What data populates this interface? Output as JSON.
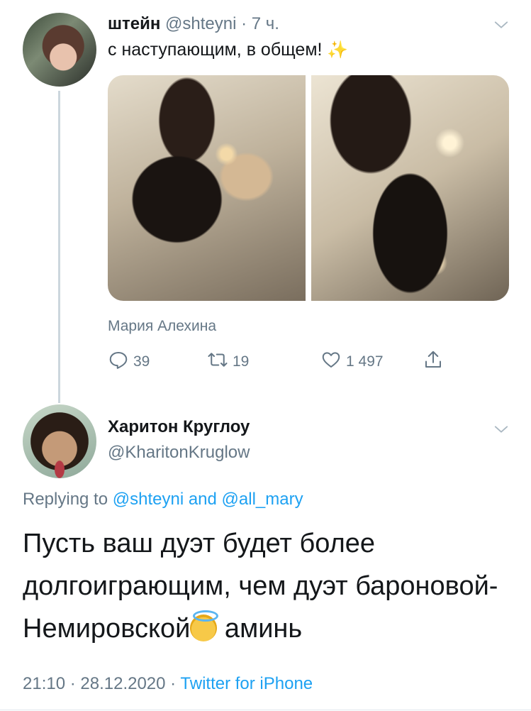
{
  "tweet": {
    "author_name": "штейн",
    "author_handle": "@shteyni",
    "time": "· 7 ч.",
    "text": "с наступающим, в общем!",
    "emoji": "✨",
    "tagged_user": "Мария Алехина",
    "stats": {
      "replies": "39",
      "retweets": "19",
      "likes": "1 497"
    }
  },
  "reply": {
    "author_name": "Харитон Круглоу",
    "author_handle": "@KharitonKruglow",
    "replying_prefix": "Replying to",
    "replying_user_1": "@shteyni",
    "replying_and": "and",
    "replying_user_2": "@all_mary",
    "text_part1": "Пусть ваш дуэт будет более долгоиграющим, чем дуэт бароновой-Немировской",
    "text_part2": " аминь",
    "timestamp": "21:10 · 28.12.2020 ·",
    "source": "Twitter for iPhone"
  },
  "icons": {
    "reply": "reply-icon",
    "retweet": "retweet-icon",
    "like": "heart-icon",
    "share": "share-icon",
    "menu": "chevron-down-icon"
  },
  "colors": {
    "accent": "#1da1f2",
    "secondary_text": "#657786",
    "primary_text": "#14171a",
    "thread_line": "#ccd6dd"
  }
}
